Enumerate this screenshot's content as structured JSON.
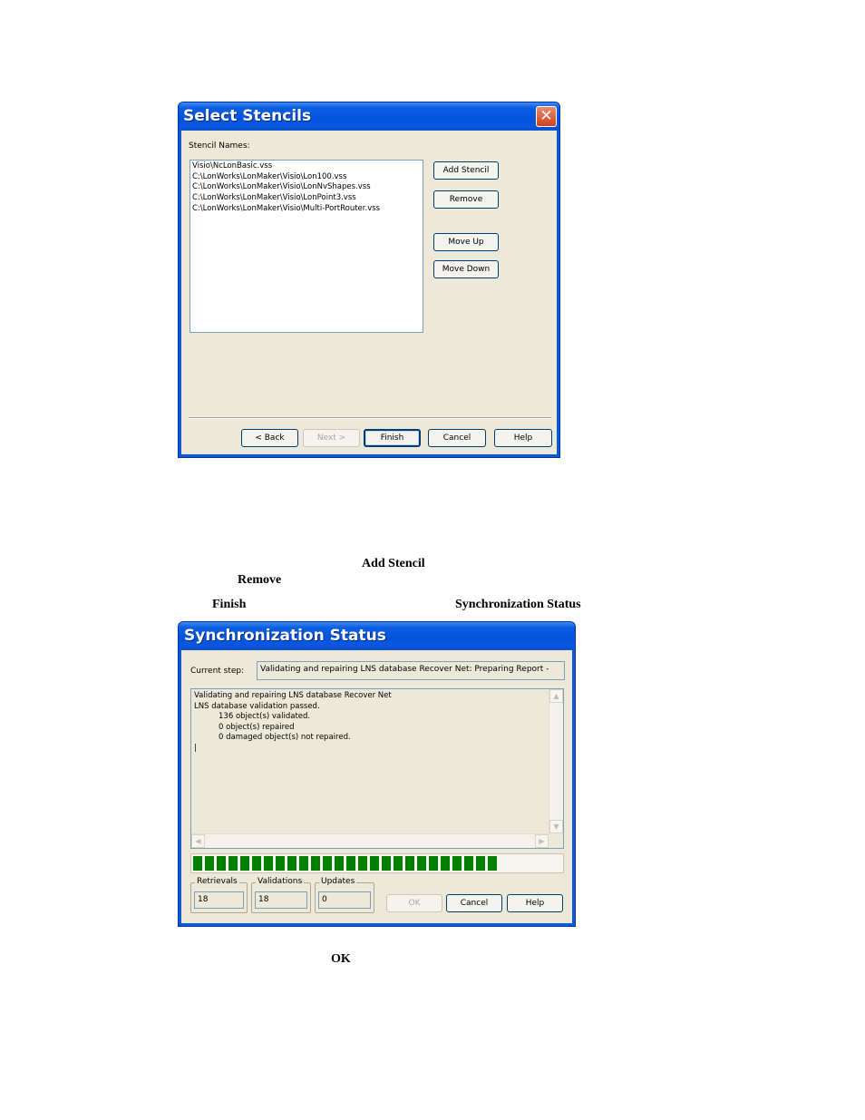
{
  "select_stencils": {
    "title": "Select Stencils",
    "stencil_names_label": "Stencil Names:",
    "stencils": [
      "Visio\\NcLonBasic.vss",
      "C:\\LonWorks\\LonMaker\\Visio\\Lon100.vss",
      "C:\\LonWorks\\LonMaker\\Visio\\LonNvShapes.vss",
      "C:\\LonWorks\\LonMaker\\Visio\\LonPoint3.vss",
      "C:\\LonWorks\\LonMaker\\Visio\\Multi-PortRouter.vss"
    ],
    "buttons": {
      "add_stencil": "Add Stencil",
      "remove": "Remove",
      "move_up": "Move Up",
      "move_down": "Move Down",
      "back": "< Back",
      "next": "Next >",
      "finish": "Finish",
      "cancel": "Cancel",
      "help": "Help"
    }
  },
  "doc_text": {
    "add_stencil": "Add Stencil",
    "remove": "Remove",
    "finish": "Finish",
    "synchronization_status": "Synchronization Status",
    "ok": "OK"
  },
  "sync_status": {
    "title": "Synchronization Status",
    "current_step_label": "Current step:",
    "current_step_value": "Validating and repairing LNS database Recover Net: Preparing Report -",
    "log_lines": [
      "Validating and repairing LNS database Recover Net",
      "LNS database validation passed.",
      "          136 object(s) validated.",
      "          0 object(s) repaired",
      "          0 damaged object(s) not repaired.",
      "|"
    ],
    "progress_percent": 85,
    "progress_color": "#008000",
    "counters": {
      "retrievals_label": "Retrievals",
      "retrievals_value": "18",
      "validations_label": "Validations",
      "validations_value": "18",
      "updates_label": "Updates",
      "updates_value": "0"
    },
    "buttons": {
      "ok": "OK",
      "cancel": "Cancel",
      "help": "Help"
    }
  },
  "icons": {
    "close": "close-icon"
  },
  "colors": {
    "titlebar": "#0553dd",
    "dialog_bg": "#ece9d8",
    "close_button": "#d0411c"
  }
}
